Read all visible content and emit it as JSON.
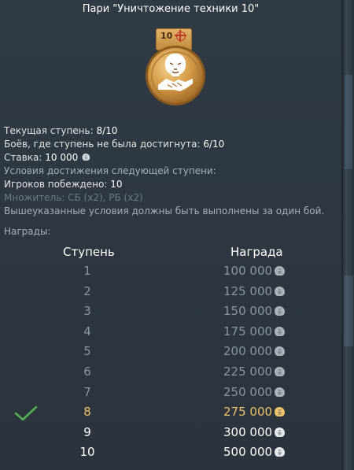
{
  "title": "Пари \"Уничтожение техники 10\"",
  "medal": {
    "level": "10",
    "icon": "lion-handshake-medal-icon"
  },
  "info": {
    "current_step_label": "Текущая ступень: ",
    "current_step_value": "8/10",
    "failed_battles_label": "Боёв, где ступень не была достигнута: ",
    "failed_battles_value": "6/10",
    "bet_label": "Ставка: ",
    "bet_value": "10 000",
    "next_step_conditions": "Условия достижения следующей ступени:",
    "players_defeated_label": "Игроков побеждено: ",
    "players_defeated_value": "10",
    "multiplier": "Множитель: СБ (x2), РБ (x2)",
    "single_battle_note": "Вышеуказанные условия должны быть выполнены за один бой.",
    "rewards_label": "Награды:"
  },
  "table": {
    "step_header": "Ступень",
    "reward_header": "Награда",
    "current_step": 8,
    "rows": [
      {
        "step": "1",
        "reward": "100 000"
      },
      {
        "step": "2",
        "reward": "125 000"
      },
      {
        "step": "3",
        "reward": "150 000"
      },
      {
        "step": "4",
        "reward": "175 000"
      },
      {
        "step": "5",
        "reward": "200 000"
      },
      {
        "step": "6",
        "reward": "225 000"
      },
      {
        "step": "7",
        "reward": "250 000"
      },
      {
        "step": "8",
        "reward": "275 000"
      },
      {
        "step": "9",
        "reward": "300 000"
      },
      {
        "step": "10",
        "reward": "500 000"
      }
    ]
  },
  "currency_icon": "silver-lion-icon",
  "colors": {
    "current_step": "#f0c46a",
    "past_step": "#8d96a0",
    "future_step": "#ffffff",
    "check": "#4fb04f"
  }
}
